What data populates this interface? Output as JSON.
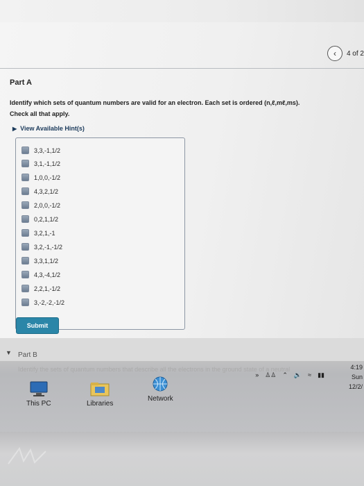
{
  "nav": {
    "page_count": "4 of 2"
  },
  "part_a": {
    "title": "Part A",
    "question": "Identify which sets of quantum numbers are valid for an electron. Each set is ordered (n,ℓ,mℓ,ms).",
    "instruction": "Check all that apply.",
    "hints_label": "View Available Hint(s)",
    "options": [
      "3,3,-1,1/2",
      "3,1,-1,1/2",
      "1,0,0,-1/2",
      "4,3,2,1/2",
      "2,0,0,-1/2",
      "0,2,1,1/2",
      "3,2,1,-1",
      "3,2,-1,-1/2",
      "3,3,1,1/2",
      "4,3,-4,1/2",
      "2,2,1,-1/2",
      "3,-2,-2,-1/2"
    ],
    "submit_label": "Submit"
  },
  "part_b": {
    "title": "Part B",
    "subtitle": "Identify the sets of quantum numbers that describe all the electrons in the ground state of a neutral"
  },
  "desktop": {
    "icons": [
      "This PC",
      "Libraries",
      "Network"
    ]
  },
  "taskbar": {
    "time": "4:19",
    "day": "Sun",
    "date": "12/2/"
  },
  "colors": {
    "submit": "#2b86a8",
    "hint_link": "#1b3a5b"
  }
}
